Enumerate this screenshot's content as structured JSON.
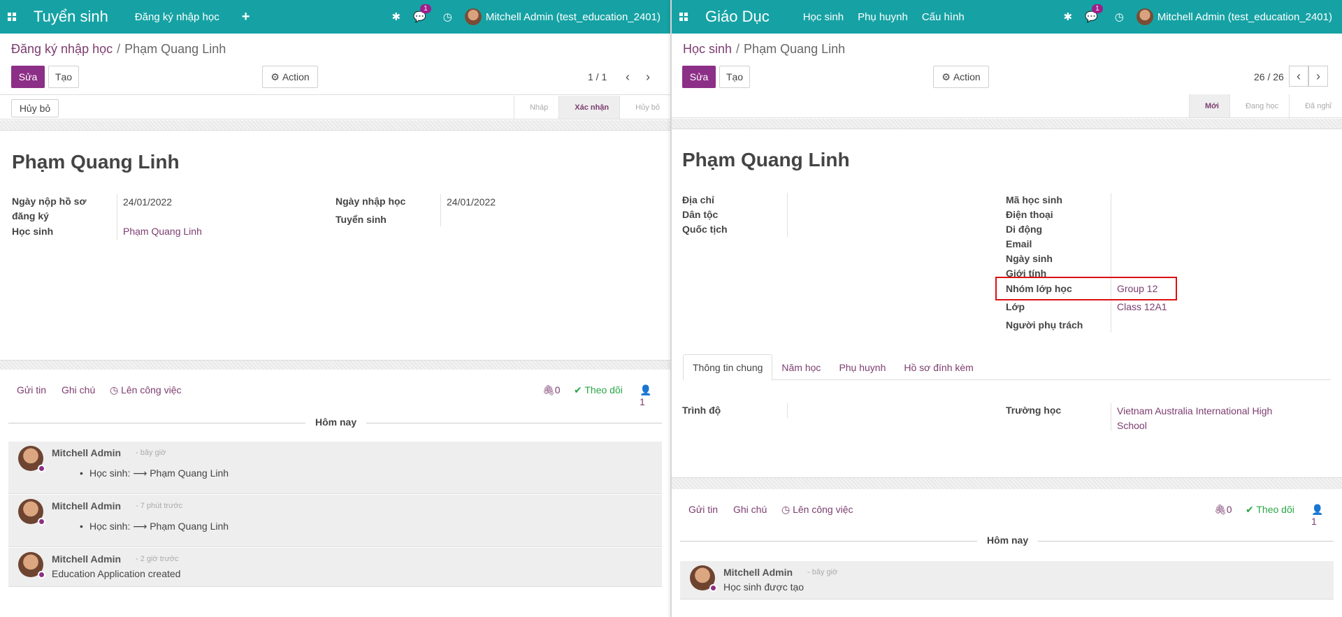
{
  "left": {
    "navbar": {
      "brand": "Tuyển sinh",
      "menu": [
        "Đăng ký nhập học"
      ],
      "user": "Mitchell Admin (test_education_2401)",
      "badge": "1",
      "color": "#16a2a4"
    },
    "breadcrumb": {
      "parent": "Đăng ký nhập học",
      "current": "Phạm Quang Linh"
    },
    "buttons": {
      "edit": "Sửa",
      "create": "Tạo",
      "action": "Action",
      "cancel": "Hủy bỏ"
    },
    "pager": "1 / 1",
    "stages": [
      "Nháp",
      "Xác nhận",
      "Hủy bỏ"
    ],
    "active_stage": "Xác nhận",
    "record": {
      "title": "Phạm Quang Linh",
      "fields_left": [
        {
          "label": "Ngày nộp hồ sơ đăng ký",
          "value": "24/01/2022"
        },
        {
          "label": "Học sinh",
          "value": "Phạm Quang Linh"
        }
      ],
      "fields_right": [
        {
          "label": "Ngày nhập học",
          "value": "24/01/2022"
        },
        {
          "label": "Tuyển sinh",
          "value": ""
        }
      ]
    },
    "chatter": {
      "send": "Gửi tin",
      "note": "Ghi chú",
      "activity": "Lên công việc",
      "attachments": "0",
      "follow": "Theo dõi",
      "followers": "1",
      "today": "Hôm nay",
      "messages": [
        {
          "author": "Mitchell Admin",
          "time": "- bây giờ",
          "bullet": "Học sinh: ⟶ Phạm Quang Linh"
        },
        {
          "author": "Mitchell Admin",
          "time": "- 7 phút trước",
          "bullet": "Học sinh: ⟶ Phạm Quang Linh"
        },
        {
          "author": "Mitchell Admin",
          "time": "- 2 giờ trước",
          "body": "Education Application created"
        }
      ]
    }
  },
  "right": {
    "navbar": {
      "brand": "Giáo Dục",
      "menu": [
        "Học sinh",
        "Phụ huynh",
        "Cấu hình"
      ],
      "user": "Mitchell Admin (test_education_2401)",
      "badge": "1"
    },
    "breadcrumb": {
      "parent": "Học sinh",
      "current": "Phạm Quang Linh"
    },
    "buttons": {
      "edit": "Sửa",
      "create": "Tạo",
      "action": "Action"
    },
    "pager": "26 / 26",
    "stages": [
      "Mới",
      "Đang học",
      "Đã nghỉ"
    ],
    "active_stage": "Mới",
    "record": {
      "title": "Phạm Quang Linh",
      "fields_left": [
        "Địa chỉ",
        "Dân tộc",
        "Quốc tịch"
      ],
      "fields_right": [
        {
          "label": "Mã học sinh",
          "value": ""
        },
        {
          "label": "Điện thoại",
          "value": ""
        },
        {
          "label": "Di động",
          "value": ""
        },
        {
          "label": "Email",
          "value": ""
        },
        {
          "label": "Ngày sinh",
          "value": ""
        },
        {
          "label": "Giới tính",
          "value": ""
        },
        {
          "label": "Nhóm lớp học",
          "value": "Group 12"
        },
        {
          "label": "Lớp",
          "value": "Class 12A1"
        },
        {
          "label": "Người phụ trách",
          "value": ""
        }
      ],
      "tabs": [
        "Thông tin chung",
        "Năm học",
        "Phụ huynh",
        "Hồ sơ đính kèm"
      ],
      "tab_fields": {
        "level_label": "Trình độ",
        "school_label": "Trường học",
        "school_value_1": "Vietnam Australia International High",
        "school_value_2": "School"
      }
    },
    "chatter": {
      "send": "Gửi tin",
      "note": "Ghi chú",
      "activity": "Lên công việc",
      "attachments": "0",
      "follow": "Theo dõi",
      "followers": "1",
      "today": "Hôm nay",
      "messages": [
        {
          "author": "Mitchell Admin",
          "time": "- bây giờ",
          "body": "Học sinh được tạo"
        }
      ]
    }
  }
}
